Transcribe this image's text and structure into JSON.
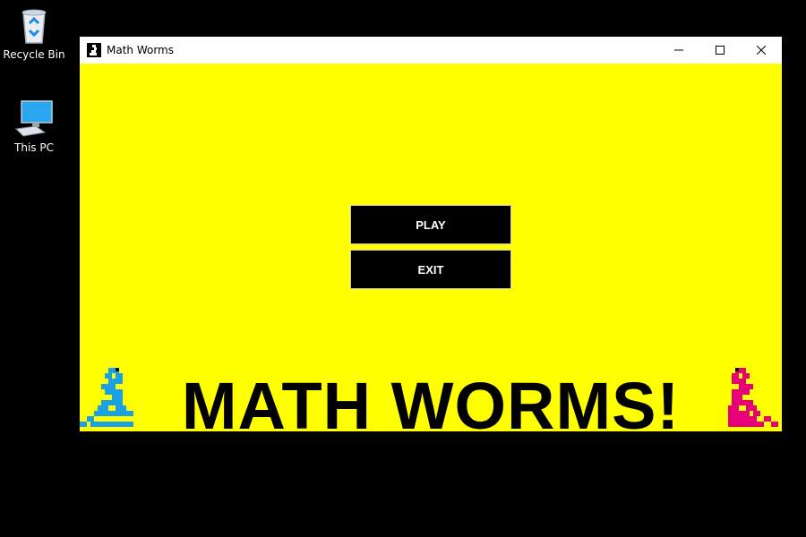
{
  "desktop": {
    "icons": [
      {
        "label": "Recycle Bin",
        "icon": "recycle-bin-icon"
      },
      {
        "label": "This PC",
        "icon": "computer-icon"
      }
    ]
  },
  "window": {
    "title": "Math Worms",
    "app_icon": "worm-icon",
    "controls": {
      "minimize": "─",
      "maximize": "☐",
      "close": "✕"
    }
  },
  "menu": {
    "play_label": "PLAY",
    "exit_label": "EXIT"
  },
  "banner": {
    "title": "MATH WORMS!"
  },
  "colors": {
    "background": "#ffff00",
    "button": "#000000",
    "worm_left": "#1aa0e8",
    "worm_right": "#e8007a"
  }
}
